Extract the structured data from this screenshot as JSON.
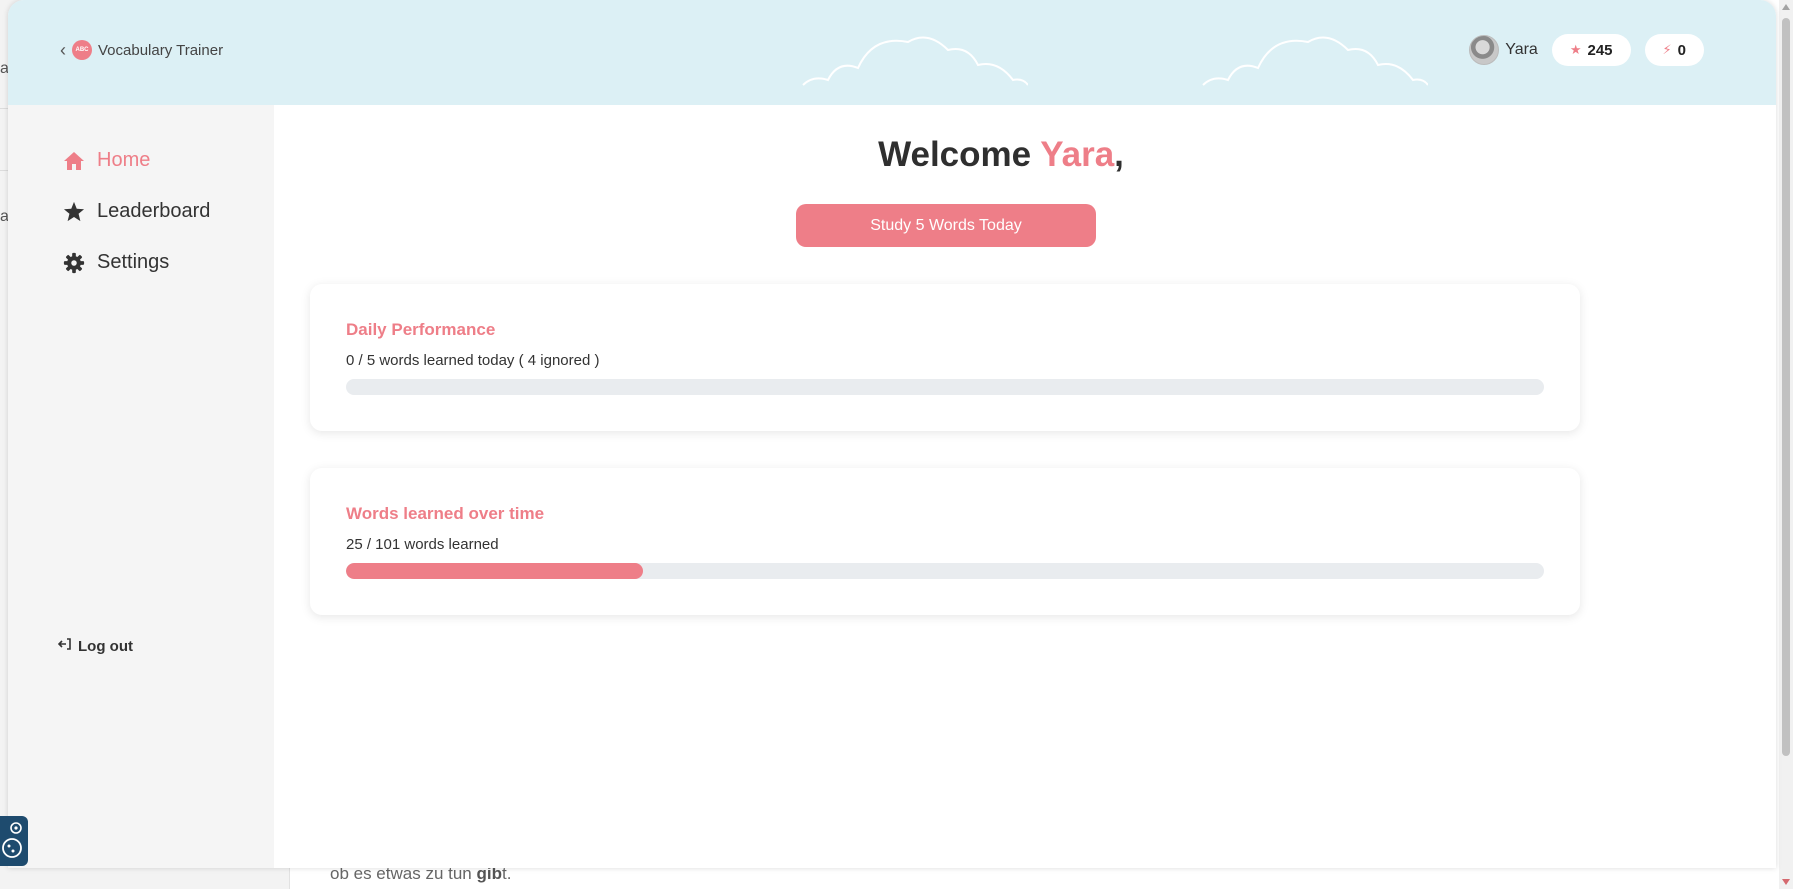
{
  "app": {
    "title": "Vocabulary Trainer",
    "logo_text": "ABC"
  },
  "header": {
    "user_name": "Yara",
    "points": "245",
    "streak": "0"
  },
  "sidebar": {
    "items": [
      {
        "label": "Home",
        "icon": "home-icon",
        "active": true
      },
      {
        "label": "Leaderboard",
        "icon": "star-icon",
        "active": false
      },
      {
        "label": "Settings",
        "icon": "gear-icon",
        "active": false
      }
    ],
    "logout_label": "Log out"
  },
  "main": {
    "welcome_prefix": "Welcome",
    "welcome_name": "Yara",
    "welcome_suffix": ",",
    "study_button": "Study 5 Words Today",
    "daily": {
      "title": "Daily Performance",
      "summary": "0 / 5 words learned today ( 4 ignored )",
      "progress": 0.0
    },
    "overall": {
      "title": "Words learned over time",
      "summary": "25 / 101 words learned",
      "progress": 0.2475
    }
  },
  "background": {
    "bottom_text_pre": "ob es etwas zu tun ",
    "bottom_text_bold": "gib",
    "bottom_text_post": "t.",
    "left_letters": [
      "a",
      "a"
    ]
  },
  "colors": {
    "accent": "#ee7e88",
    "header_bg": "#dcf0f5",
    "sidebar_bg": "#f5f5f5",
    "track": "#e9ecef"
  }
}
